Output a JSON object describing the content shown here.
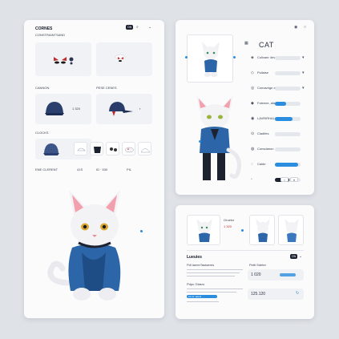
{
  "left": {
    "title": "CORNES",
    "subtitle": "CONSTRAINTSAND",
    "chip": "ON",
    "icon_a": "search-icon",
    "icon_b": "chevron-down-icon",
    "section_b_label": "CANNON",
    "section_b_label2": "PESE CENES",
    "hat_price_a": "1 320",
    "section_c_label": "CLOCKS",
    "footer_a": "ENE CLERENT",
    "footer_b": "41S",
    "footer_c": "ID · 530",
    "footer_d": "PIL"
  },
  "right_top": {
    "heading": "CAT",
    "rows": [
      {
        "label": "Colivanr 4eva",
        "value": 0.0,
        "end": "▾"
      },
      {
        "label": "Pullaise",
        "value": 0.0,
        "end": "▾"
      },
      {
        "label": "Comavrige aige",
        "value": 0.0,
        "end": "▾"
      },
      {
        "label": "Foleene, afarrrest",
        "value": 0.45,
        "end": ""
      },
      {
        "label": "LAVRIRHALOR",
        "value": 0.7,
        "end": ""
      },
      {
        "label": "Cladifes",
        "value": 0.0,
        "end": ""
      },
      {
        "label": "Consdanon",
        "value": 0.0,
        "end": ""
      },
      {
        "label": "Calde",
        "value": 0.9,
        "end": ""
      },
      {
        "label": "",
        "value": 0.55,
        "end": ""
      }
    ],
    "colors": {
      "accent": "#2a8de0",
      "dark": "#1d2230"
    }
  },
  "right_bottom": {
    "caption_a": "Gruetcr",
    "price_a": "1 320",
    "section_label": "Lueuies",
    "chip": "ON",
    "para_label": "Pdl lamerTastaeres",
    "field_label_a": "Petti Sdeter",
    "field_value_a": "1 020",
    "para_label2": "Pdpu Glasro",
    "field_value_b": "125.120",
    "link_text": "Liu lu: aoeoi"
  }
}
